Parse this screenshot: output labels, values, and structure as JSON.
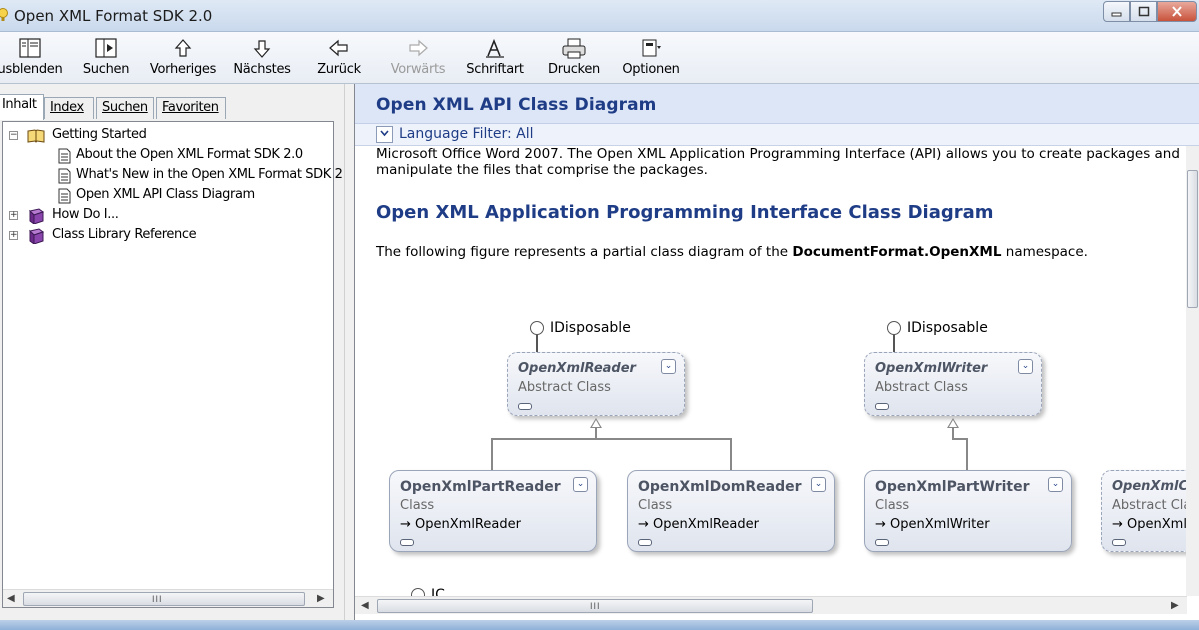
{
  "window": {
    "title": "Open XML Format SDK 2.0"
  },
  "toolbar": {
    "items": [
      {
        "label": "usblenden",
        "icon": "hide-pane-icon"
      },
      {
        "label": "Suchen",
        "icon": "locate-icon"
      },
      {
        "label": "Vorheriges",
        "icon": "arrow-up-icon"
      },
      {
        "label": "Nächstes",
        "icon": "arrow-down-icon"
      },
      {
        "label": "Zurück",
        "icon": "arrow-left-icon"
      },
      {
        "label": "Vorwärts",
        "icon": "arrow-right-icon",
        "disabled": true
      },
      {
        "label": "Schriftart",
        "icon": "font-icon"
      },
      {
        "label": "Drucken",
        "icon": "printer-icon"
      },
      {
        "label": "Optionen",
        "icon": "options-icon"
      }
    ]
  },
  "nav": {
    "tabs": [
      {
        "label": "Inhalt",
        "active": true
      },
      {
        "label": "Index"
      },
      {
        "label": "Suchen"
      },
      {
        "label": "Favoriten"
      }
    ],
    "tree": [
      {
        "label": "Getting Started",
        "level": 0,
        "expander": "−",
        "icon": "open-book-icon"
      },
      {
        "label": "About the Open XML Format SDK 2.0",
        "level": 1,
        "icon": "page-icon"
      },
      {
        "label": "What's New in the Open XML Format SDK 2",
        "level": 1,
        "icon": "page-icon"
      },
      {
        "label": "Open XML API Class Diagram",
        "level": 1,
        "icon": "page-icon",
        "selected": true
      },
      {
        "label": "How Do I...",
        "level": 0,
        "expander": "+",
        "icon": "book-icon"
      },
      {
        "label": "Class Library Reference",
        "level": 0,
        "expander": "+",
        "icon": "book-icon"
      }
    ]
  },
  "topic": {
    "header_title": "Open XML API Class Diagram",
    "language_filter": "Language Filter: All",
    "intro_text": "Microsoft Office Word 2007. The Open XML Application Programming Interface (API) allows you to create packages and manipulate the files that comprise the packages.",
    "heading": "Open XML Application Programming Interface Class Diagram",
    "para_before": "The following figure represents a partial class diagram of the ",
    "para_bold": "DocumentFormat.OpenXML",
    "para_after": " namespace.",
    "partial_label": "IC"
  },
  "diagram": {
    "interfaces": [
      {
        "name": "IDisposable"
      },
      {
        "name": "IDisposable"
      }
    ],
    "classes": [
      {
        "name": "OpenXmlReader",
        "type": "Abstract Class",
        "base": ""
      },
      {
        "name": "OpenXmlWriter",
        "type": "Abstract Class",
        "base": ""
      },
      {
        "name": "OpenXmlPartReader",
        "type": "Class",
        "base": "OpenXmlReader"
      },
      {
        "name": "OpenXmlDomReader",
        "type": "Class",
        "base": "OpenXmlReader"
      },
      {
        "name": "OpenXmlPartWriter",
        "type": "Class",
        "base": "OpenXmlWriter"
      },
      {
        "name": "OpenXmlCo",
        "type": "Abstract Cla",
        "base": "OpenXml"
      }
    ]
  },
  "scrollbar": {
    "grip": "III"
  },
  "colors": {
    "heading": "#1f3d86",
    "header_band": "#dde6f7"
  }
}
